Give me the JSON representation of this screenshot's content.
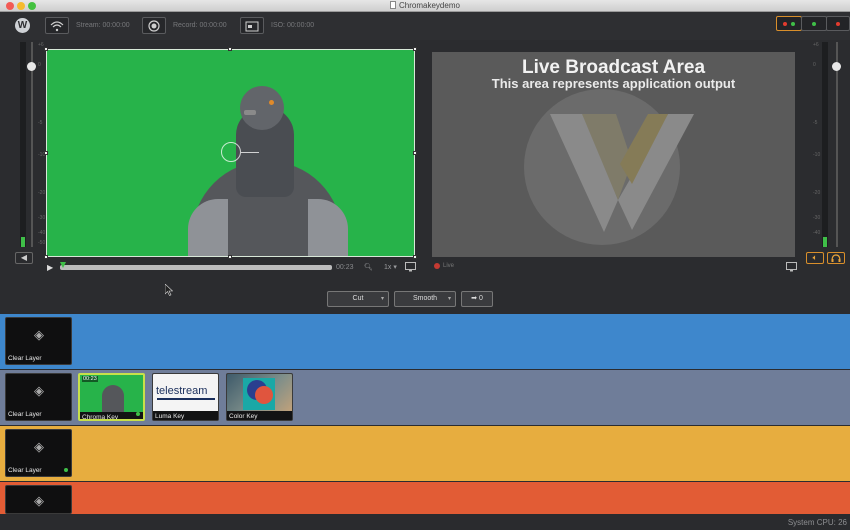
{
  "window": {
    "title": "Chromakeydemo"
  },
  "toolbar": {
    "logo": "W",
    "stream_label": "Stream: 00:00:00",
    "record_label": "Record: 00:00:00",
    "iso_label": "ISO: 00:00:00",
    "icons": [
      "wifi-icon",
      "record-icon",
      "iso-icon"
    ]
  },
  "status_indicators": {
    "colors": {
      "red": "#e23b2e",
      "green": "#3fbf48",
      "orange": "#d98f2b"
    }
  },
  "meter_scale": [
    "+6",
    "0",
    "-5",
    "-10",
    "-20",
    "-30",
    "-40",
    "-50"
  ],
  "preview": {
    "background_color": "#27b34a",
    "timecode": "00:23",
    "speed": "1x",
    "progress": 0.99
  },
  "output": {
    "title": "Live Broadcast Area",
    "subtitle": "This area represents application output",
    "live_label": "Live"
  },
  "transition": {
    "type": "Cut",
    "effect": "Smooth",
    "go_label": "0"
  },
  "layers": [
    {
      "color": "#3e87cc",
      "clips": [
        {
          "label": "Clear Layer"
        }
      ]
    },
    {
      "color": "#6f7d99",
      "clips": [
        {
          "label": "Clear Layer"
        },
        {
          "label": "Chroma Key",
          "timecode": "00:23"
        },
        {
          "label": "Luma Key",
          "logo_text": "telestream"
        },
        {
          "label": "Color Key"
        }
      ]
    },
    {
      "color": "#e7ad3f",
      "clips": [
        {
          "label": "Clear Layer"
        }
      ]
    },
    {
      "color": "#e25c35",
      "clips": [
        {
          "label": "Clear Layer"
        }
      ]
    }
  ],
  "footer": {
    "cpu_label": "System CPU:",
    "cpu_value": "26"
  }
}
